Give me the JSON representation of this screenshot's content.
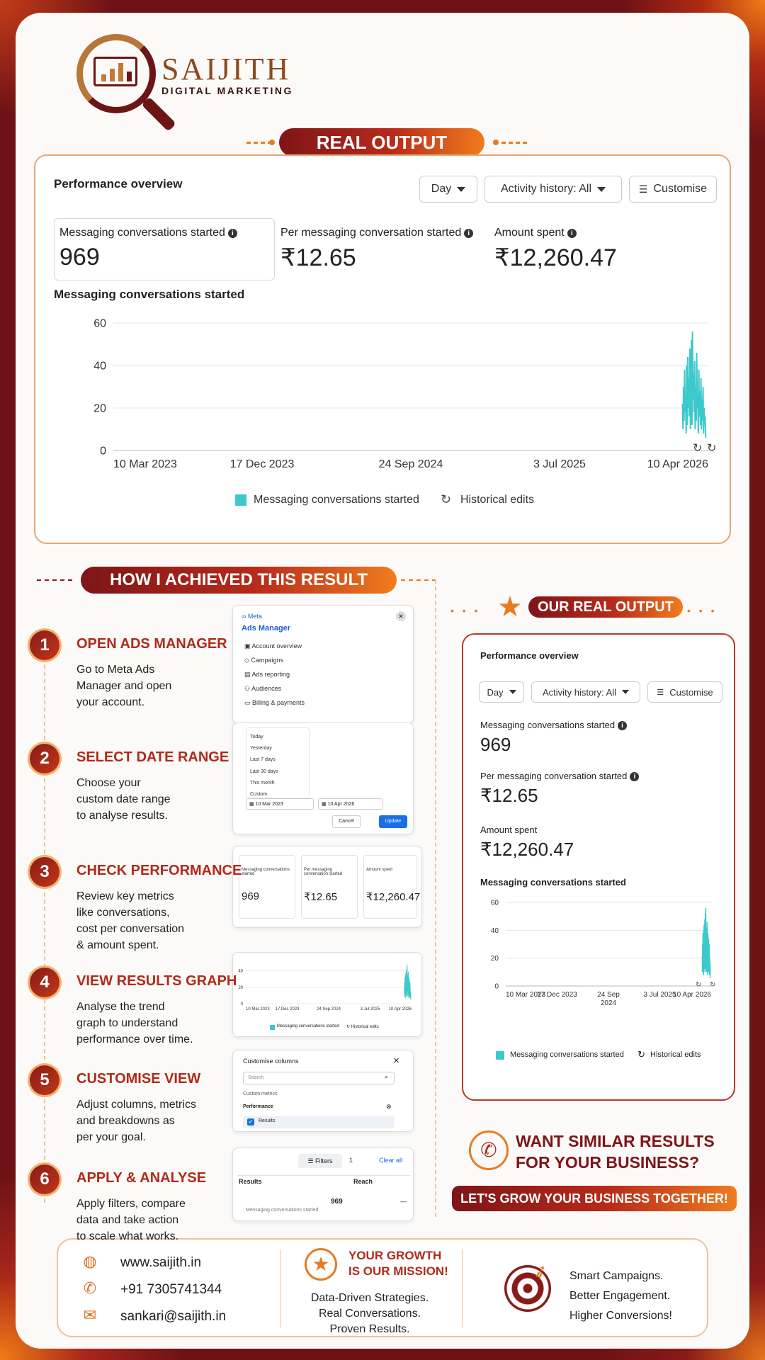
{
  "brand": {
    "name": "SAIJITH",
    "tagline": "DIGITAL MARKETING"
  },
  "headings": {
    "real_output": "REAL OUTPUT",
    "how": "HOW I ACHIEVED THIS RESULT",
    "our_real_output": "OUR REAL OUTPUT"
  },
  "overview": {
    "title": "Performance overview",
    "day": "Day",
    "activity": "Activity history: All",
    "customise": "Customise",
    "metrics": [
      {
        "label": "Messaging conversations started",
        "value": "969"
      },
      {
        "label": "Per messaging conversation started",
        "value": "₹12.65"
      },
      {
        "label": "Amount spent",
        "value": "₹12,260.47"
      }
    ],
    "chart_title": "Messaging conversations started",
    "legend_series": "Messaging conversations started",
    "legend_edits": "Historical edits"
  },
  "chart_data": {
    "type": "line",
    "title": "Messaging conversations started",
    "x_tick_labels": [
      "10 Mar 2023",
      "17 Dec 2023",
      "24 Sep 2024",
      "3 Jul 2025",
      "10 Apr 2026"
    ],
    "y_ticks": [
      0,
      20,
      40,
      60
    ],
    "ylim": [
      0,
      60
    ],
    "series": [
      {
        "name": "Messaging conversations started",
        "color": "#3cc9cc",
        "x": [
          "2026-02-20",
          "2026-02-21",
          "2026-02-22",
          "2026-02-23",
          "2026-02-24",
          "2026-02-25",
          "2026-02-26",
          "2026-02-27",
          "2026-02-28",
          "2026-03-01",
          "2026-03-02",
          "2026-03-03",
          "2026-03-04",
          "2026-03-05",
          "2026-03-06",
          "2026-03-07",
          "2026-03-08",
          "2026-03-09",
          "2026-03-10",
          "2026-03-11",
          "2026-03-12",
          "2026-03-13",
          "2026-03-14",
          "2026-03-15",
          "2026-03-16",
          "2026-03-17",
          "2026-03-18",
          "2026-03-19",
          "2026-03-20",
          "2026-03-21",
          "2026-03-22",
          "2026-03-23",
          "2026-03-24",
          "2026-03-25",
          "2026-03-26",
          "2026-03-27",
          "2026-03-28",
          "2026-03-29",
          "2026-03-30",
          "2026-03-31",
          "2026-04-01",
          "2026-04-02",
          "2026-04-03",
          "2026-04-04",
          "2026-04-05"
        ],
        "y": [
          22,
          10,
          30,
          14,
          38,
          18,
          26,
          8,
          40,
          12,
          44,
          20,
          34,
          16,
          48,
          10,
          28,
          52,
          12,
          56,
          24,
          36,
          18,
          42,
          10,
          30,
          14,
          46,
          20,
          26,
          8,
          38,
          16,
          28,
          12,
          34,
          10,
          24,
          14,
          30,
          8,
          20,
          12,
          16,
          6
        ]
      }
    ],
    "grid": true,
    "legend": "bottom"
  },
  "steps": [
    {
      "num": "1",
      "title": "OPEN ADS MANAGER",
      "desc": [
        "Go to Meta Ads",
        "Manager and open",
        "your account."
      ]
    },
    {
      "num": "2",
      "title": "SELECT DATE RANGE",
      "desc": [
        "Choose your",
        "custom date range",
        "to analyse results."
      ]
    },
    {
      "num": "3",
      "title": "CHECK PERFORMANCE",
      "desc": [
        "Review key metrics",
        "like conversations,",
        "cost per conversation",
        "& amount spent."
      ]
    },
    {
      "num": "4",
      "title": "VIEW RESULTS GRAPH",
      "desc": [
        "Analyse the trend",
        "graph to understand",
        "performance over time."
      ]
    },
    {
      "num": "5",
      "title": "CUSTOMISE VIEW",
      "desc": [
        "Adjust columns, metrics",
        "and breakdowns as",
        "per your goal."
      ]
    },
    {
      "num": "6",
      "title": "APPLY & ANALYSE",
      "desc": [
        "Apply filters, compare",
        "data and take action",
        "to scale what works."
      ]
    }
  ],
  "mini1": {
    "meta": "Meta",
    "title": "Ads Manager",
    "items": [
      "Account overview",
      "Campaigns",
      "Ads reporting",
      "Audiences",
      "Billing & payments"
    ]
  },
  "mini2": {
    "options": [
      "Today",
      "Yesterday",
      "Last 7 days",
      "Last 30 days",
      "This month",
      "Custom"
    ],
    "from": "10 Mar 2023",
    "to": "10 Apr 2026",
    "cancel": "Cancel",
    "update": "Update"
  },
  "mini3": {
    "labels": [
      "Messaging conversations started",
      "Per messaging conversation started",
      "Amount spent"
    ],
    "values": [
      "969",
      "₹12.65",
      "₹12,260.47"
    ]
  },
  "mini4": {
    "y": [
      "40",
      "20",
      "0"
    ],
    "x": [
      "10 Mar 2023",
      "17 Dec 2023",
      "24 Sep 2024",
      "3 Jul 2025",
      "10 Apr 2026"
    ],
    "legend1": "Messaging conversations started",
    "legend2": "Historical edits"
  },
  "mini5": {
    "title": "Customise columns",
    "search": "Search",
    "custom": "Custom metrics",
    "performance": "Performance",
    "results": "Results"
  },
  "mini6": {
    "filters": "Filters",
    "count": "1",
    "clear": "Clear all",
    "col1": "Results",
    "col2": "Reach",
    "value": "969",
    "sub": "Messaging conversations started",
    "dash": "—"
  },
  "side_x_labels": [
    "10 Mar 2023",
    "17 Dec 2023",
    "24 Sep",
    "2024",
    "3 Jul 2025",
    "10 Apr 2026"
  ],
  "cta": {
    "line1": "WANT SIMILAR RESULTS",
    "line2": "FOR YOUR BUSINESS?",
    "bar": "LET'S GROW YOUR BUSINESS TOGETHER!"
  },
  "contact": {
    "web": "www.saijith.in",
    "phone": "+91 7305741344",
    "email": "sankari@saijith.in"
  },
  "mission": {
    "l1": "YOUR GROWTH",
    "l2": "IS OUR MISSION!",
    "d1": "Data-Driven Strategies.",
    "d2": "Real Conversations.",
    "d3": "Proven Results."
  },
  "tagline": {
    "l1": "Smart Campaigns.",
    "l2": "Better Engagement.",
    "l3": "Higher Conversions!"
  }
}
